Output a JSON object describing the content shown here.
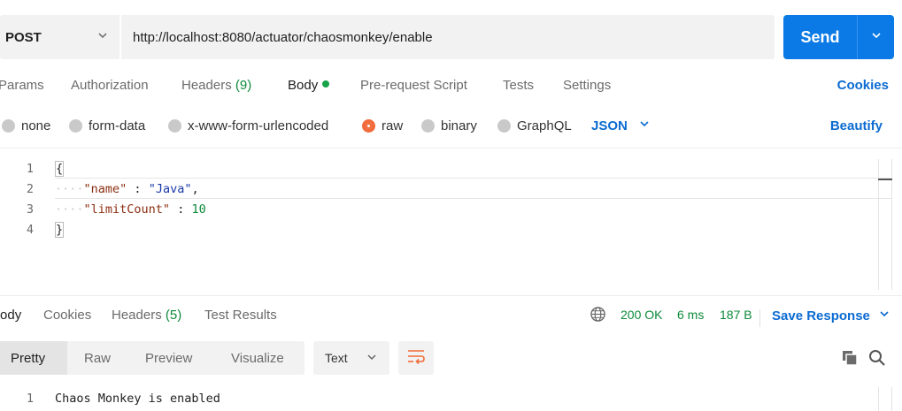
{
  "request": {
    "method": "POST",
    "url": "http://localhost:8080/actuator/chaosmonkey/enable",
    "send_label": "Send"
  },
  "request_tabs": {
    "params": "Params",
    "authorization": "Authorization",
    "headers": "Headers",
    "headers_count": "(9)",
    "body": "Body",
    "pre_request": "Pre-request Script",
    "tests": "Tests",
    "settings": "Settings",
    "cookies": "Cookies"
  },
  "body_types": {
    "none": "none",
    "form_data": "form-data",
    "urlencoded": "x-www-form-urlencoded",
    "raw": "raw",
    "binary": "binary",
    "graphql": "GraphQL",
    "selected": "raw",
    "format": "JSON",
    "beautify": "Beautify"
  },
  "editor": {
    "lines": [
      {
        "num": "1",
        "open": "{"
      },
      {
        "num": "2",
        "key": "\"name\"",
        "sep": " : ",
        "value": "\"Java\"",
        "trail": ","
      },
      {
        "num": "3",
        "key": "\"limitCount\"",
        "sep": " : ",
        "value": "10"
      },
      {
        "num": "4",
        "close": "}"
      }
    ]
  },
  "response_tabs": {
    "body": "Body",
    "cookies": "Cookies",
    "headers": "Headers",
    "headers_count": "(5)",
    "test_results": "Test Results"
  },
  "response_status": {
    "status": "200 OK",
    "time": "6 ms",
    "size": "187 B",
    "save_response": "Save Response"
  },
  "view_modes": {
    "pretty": "Pretty",
    "raw": "Raw",
    "preview": "Preview",
    "visualize": "Visualize",
    "text_format": "Text"
  },
  "response_body": {
    "line_num": "1",
    "text": "Chaos Monkey is enabled"
  },
  "colors": {
    "accent": "#0b7ae6",
    "link": "#0b6bd1",
    "success": "#0d8a3a",
    "radio_selected": "#f26b3a"
  },
  "icons": [
    "chevron-down-icon",
    "globe-icon",
    "copy-icon",
    "search-icon",
    "wrap-lines-icon"
  ]
}
